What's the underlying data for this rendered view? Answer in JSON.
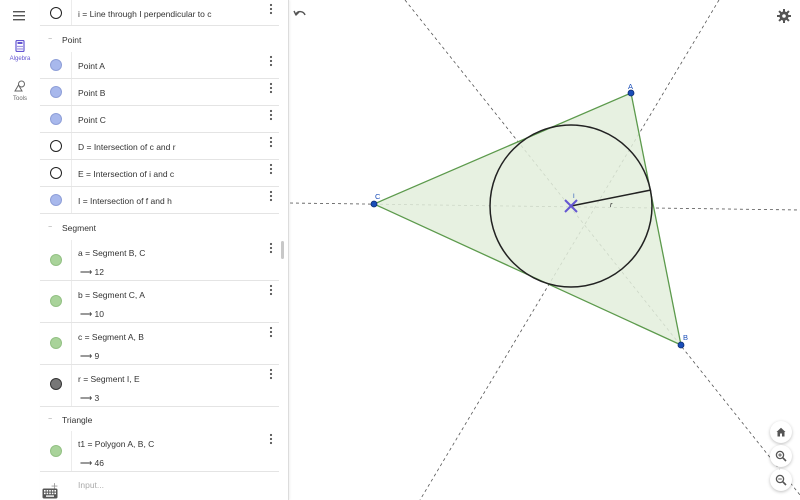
{
  "rail": {
    "algebra_label": "Algebra",
    "tools_label": "Tools"
  },
  "algebra": {
    "top_row": {
      "definition": "i = Line through I perpendicular to c"
    },
    "groups": {
      "point": "Point",
      "segment": "Segment",
      "triangle": "Triangle"
    },
    "points": [
      {
        "definition": "Point A"
      },
      {
        "definition": "Point B"
      },
      {
        "definition": "Point C"
      },
      {
        "definition": "D = Intersection of c and r"
      },
      {
        "definition": "E = Intersection of i and c"
      },
      {
        "definition": "I = Intersection of f and h"
      }
    ],
    "segments": [
      {
        "definition": "a = Segment B, C",
        "value": "⟶  12"
      },
      {
        "definition": "b = Segment C, A",
        "value": "⟶  10"
      },
      {
        "definition": "c = Segment A, B",
        "value": "⟶  9"
      },
      {
        "definition": "r = Segment I, E",
        "value": "⟶  3"
      }
    ],
    "triangles": [
      {
        "definition": "t1 = Polygon A, B, C",
        "value": "⟶  46"
      }
    ],
    "input_placeholder": "Input..."
  },
  "graphics": {
    "labels": {
      "A": "A",
      "B": "B",
      "C": "C",
      "I": "I",
      "r": "r"
    },
    "colors": {
      "triangle_stroke": "#5c9a4c",
      "triangle_fill": "#e3efdc",
      "point": "#1a4db8",
      "incenter": "#6557d2"
    }
  },
  "icons": {
    "menu": "menu-icon",
    "algebra": "calculator-icon",
    "tools": "shapes-icon",
    "undo": "undo-icon",
    "settings": "gear-icon",
    "home": "home-icon",
    "zoom_in": "zoom-in-icon",
    "zoom_out": "zoom-out-icon",
    "keyboard": "keyboard-icon"
  }
}
